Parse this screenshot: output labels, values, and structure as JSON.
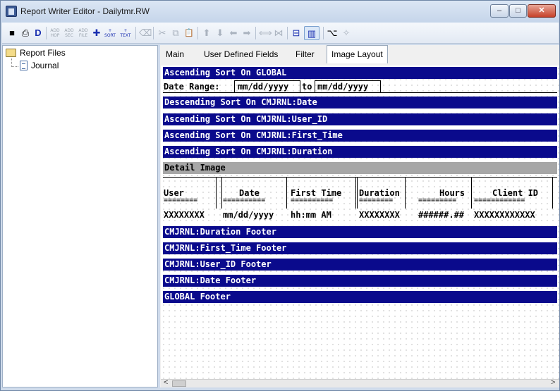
{
  "window": {
    "title": "Report Writer Editor - Dailytmr.RW",
    "controls": [
      "–",
      "□",
      "✕"
    ]
  },
  "toolbar": {
    "save": "■",
    "print": "⎙",
    "d": "D",
    "add_hop": "ADD\nHOP",
    "add_sec": "ADD\nSEC",
    "add_file": "ADD\nFILE",
    "plus": "✚",
    "sort": "+\nSORT",
    "text": "+\nTEXT",
    "delete": "⌫",
    "cut": "✂",
    "copy": "⧉",
    "paste": "📋",
    "up": "⬆",
    "down": "⬇",
    "left": "⬅",
    "right": "➡",
    "expand": "⟺",
    "collapse": "⋈",
    "band_view": "⊟",
    "field_view": "▥",
    "tree_view": "⌥",
    "wand": "✧"
  },
  "tree": {
    "root_label": "Report Files",
    "child_label": "Journal"
  },
  "tabs": [
    {
      "label": "Main"
    },
    {
      "label": "User Defined Fields"
    },
    {
      "label": "Filter"
    },
    {
      "label": "Image Layout"
    }
  ],
  "layout": {
    "bands": {
      "sort_global": "Ascending Sort On GLOBAL",
      "desc_date": "Descending Sort On CMJRNL:Date",
      "asc_user": "Ascending Sort On CMJRNL:User_ID",
      "asc_first": "Ascending Sort On CMJRNL:First_Time",
      "asc_duration": "Ascending Sort On CMJRNL:Duration",
      "detail": "Detail Image",
      "foot_duration": "CMJRNL:Duration Footer",
      "foot_first": "CMJRNL:First_Time Footer",
      "foot_user": "CMJRNL:User_ID Footer",
      "foot_date": "CMJRNL:Date Footer",
      "foot_global": "GLOBAL Footer"
    },
    "date_range": {
      "label": "Date Range:",
      "from": "mm/dd/yyyy",
      "to_word": "to",
      "to": "mm/dd/yyyy"
    },
    "columns": [
      {
        "header": "User",
        "rule": "========",
        "value": "XXXXXXXX"
      },
      {
        "header": "Date",
        "rule": "==========",
        "value": "mm/dd/yyyy"
      },
      {
        "header": "First Time",
        "rule": "==========",
        "value": "hh:mm AM"
      },
      {
        "header": "Duration",
        "rule": "========",
        "value": "XXXXXXXX"
      },
      {
        "header": "Hours",
        "rule": "=========",
        "value": "######.##"
      },
      {
        "header": "Client ID",
        "rule": "============",
        "value": "XXXXXXXXXXXX"
      }
    ]
  },
  "scrollbar": {
    "left": "<",
    "right": ">"
  }
}
